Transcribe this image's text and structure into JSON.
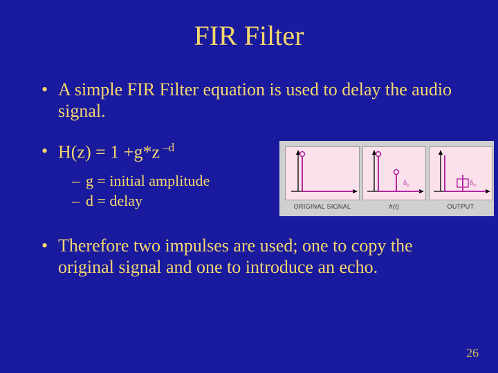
{
  "title": "FIR Filter",
  "bullets": {
    "b1": "A simple FIR Filter equation is used to delay the audio signal.",
    "b2_pre": "H(z) = 1 +g*z",
    "b2_sup": " –d",
    "b2_sub_g": "g = initial amplitude",
    "b2_sub_d": "d = delay",
    "b3": "Therefore two impulses are used; one to copy the original signal and one to introduce an echo."
  },
  "diagram": {
    "panel1_caption": "ORIGINAL SIGNAL",
    "panel2_caption": "h(t)",
    "panel3_caption": "OUTPUT",
    "delta_label": "δ₀"
  },
  "page_number": "26"
}
